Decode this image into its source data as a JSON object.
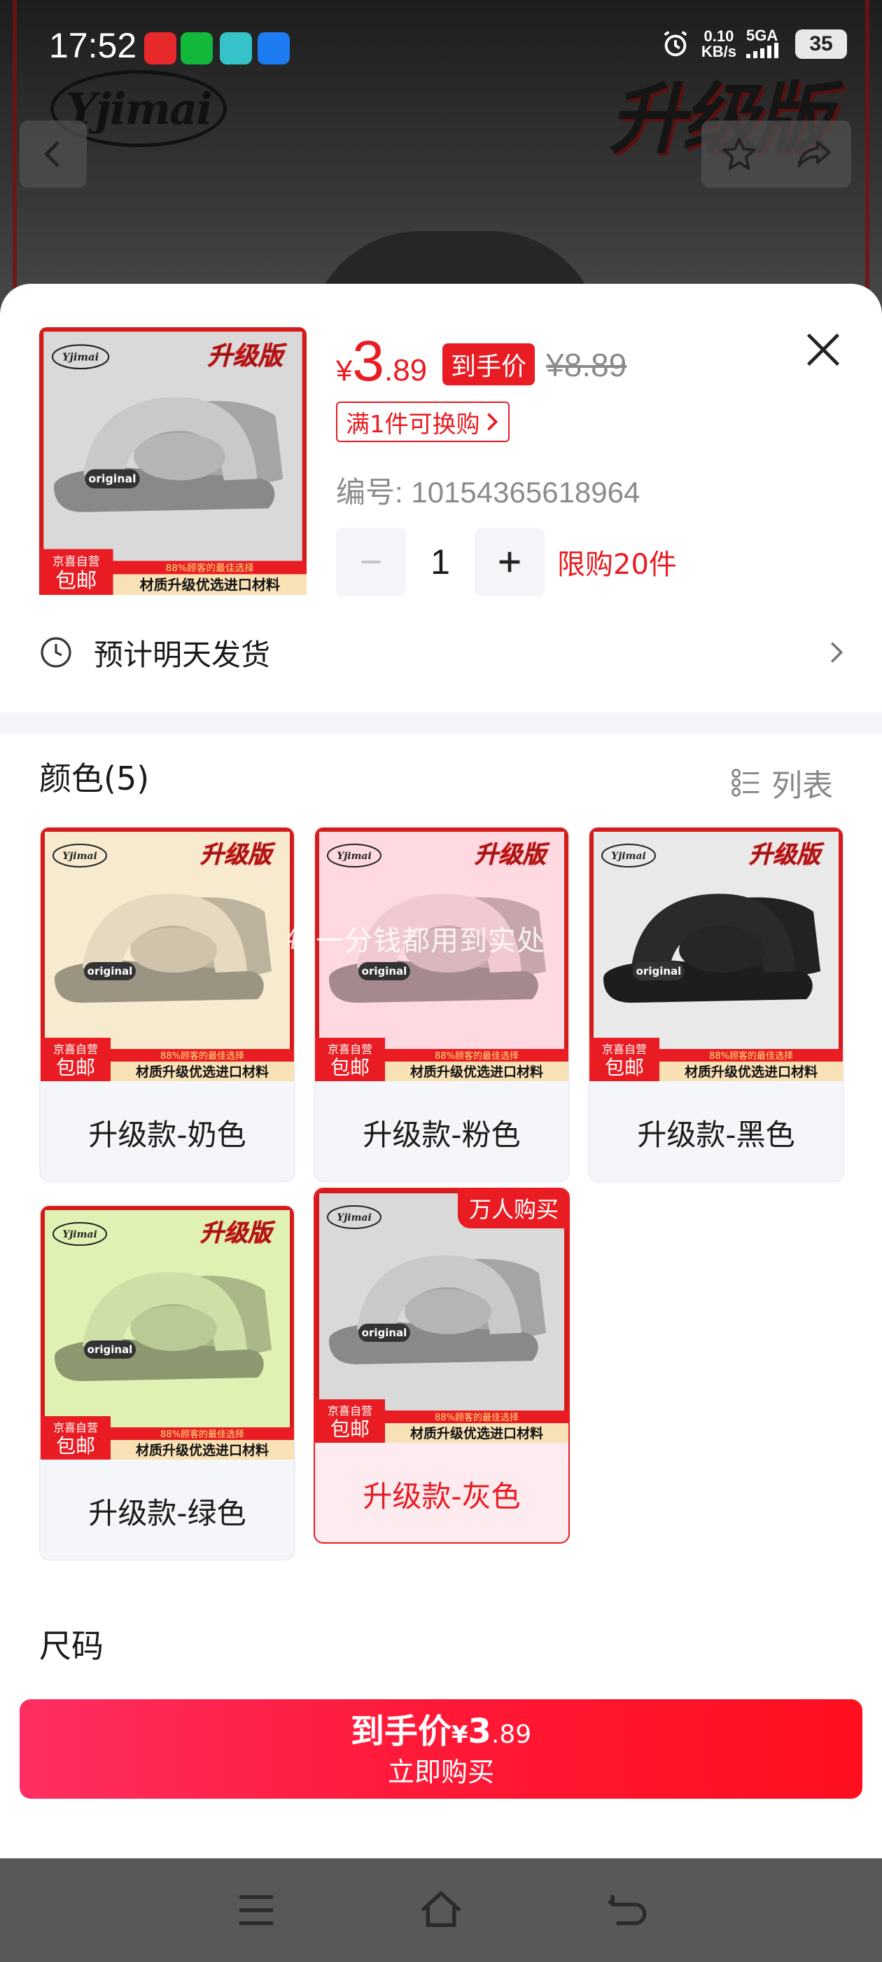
{
  "status_bar": {
    "time": "17:52",
    "net_speed": "0.10",
    "net_unit": "KB/s",
    "network": "5GA",
    "battery": "35"
  },
  "background": {
    "brand_logo": "Yjimai",
    "badge": "升级版"
  },
  "product": {
    "price_symbol": "¥",
    "price_int": "3",
    "price_dec": ".89",
    "final_price_tag": "到手价",
    "original_price": "¥8.89",
    "swap_offer": "满1件可换购",
    "sku": "编号: 10154365618964",
    "quantity": "1",
    "purchase_limit": "限购20件",
    "shipping": "预计明天发货",
    "thumb_texts": {
      "logo": "Yjimai",
      "badge": "升级版",
      "shoe_label": "original",
      "ship_badge_top": "京喜自营",
      "ship_badge": "包邮",
      "banner_top": "88%顾客的最佳选择",
      "banner": "材质升级优选进口材料"
    }
  },
  "color_section": {
    "title": "颜色(5)",
    "list_label": "列表",
    "options": [
      {
        "label": "升级款-奶色",
        "hot": ""
      },
      {
        "label": "升级款-粉色",
        "hot": ""
      },
      {
        "label": "升级款-黑色",
        "hot": ""
      },
      {
        "label": "升级款-绿色",
        "hot": ""
      },
      {
        "label": "升级款-灰色",
        "hot": "万人购买"
      }
    ],
    "watermark": "每一分钱都用到实处"
  },
  "size_section": {
    "title": "尺码"
  },
  "buy_button": {
    "prefix": "到手价",
    "symbol": "¥",
    "int": "3",
    "dec": ".89",
    "action": "立即购买"
  },
  "colors": {
    "accent": "#e81c22",
    "cream": "#e6d9bf",
    "pink": "#f1c9d1",
    "black": "#2a2a2a",
    "green": "#cfe0a6",
    "gray": "#c9c9c9"
  }
}
